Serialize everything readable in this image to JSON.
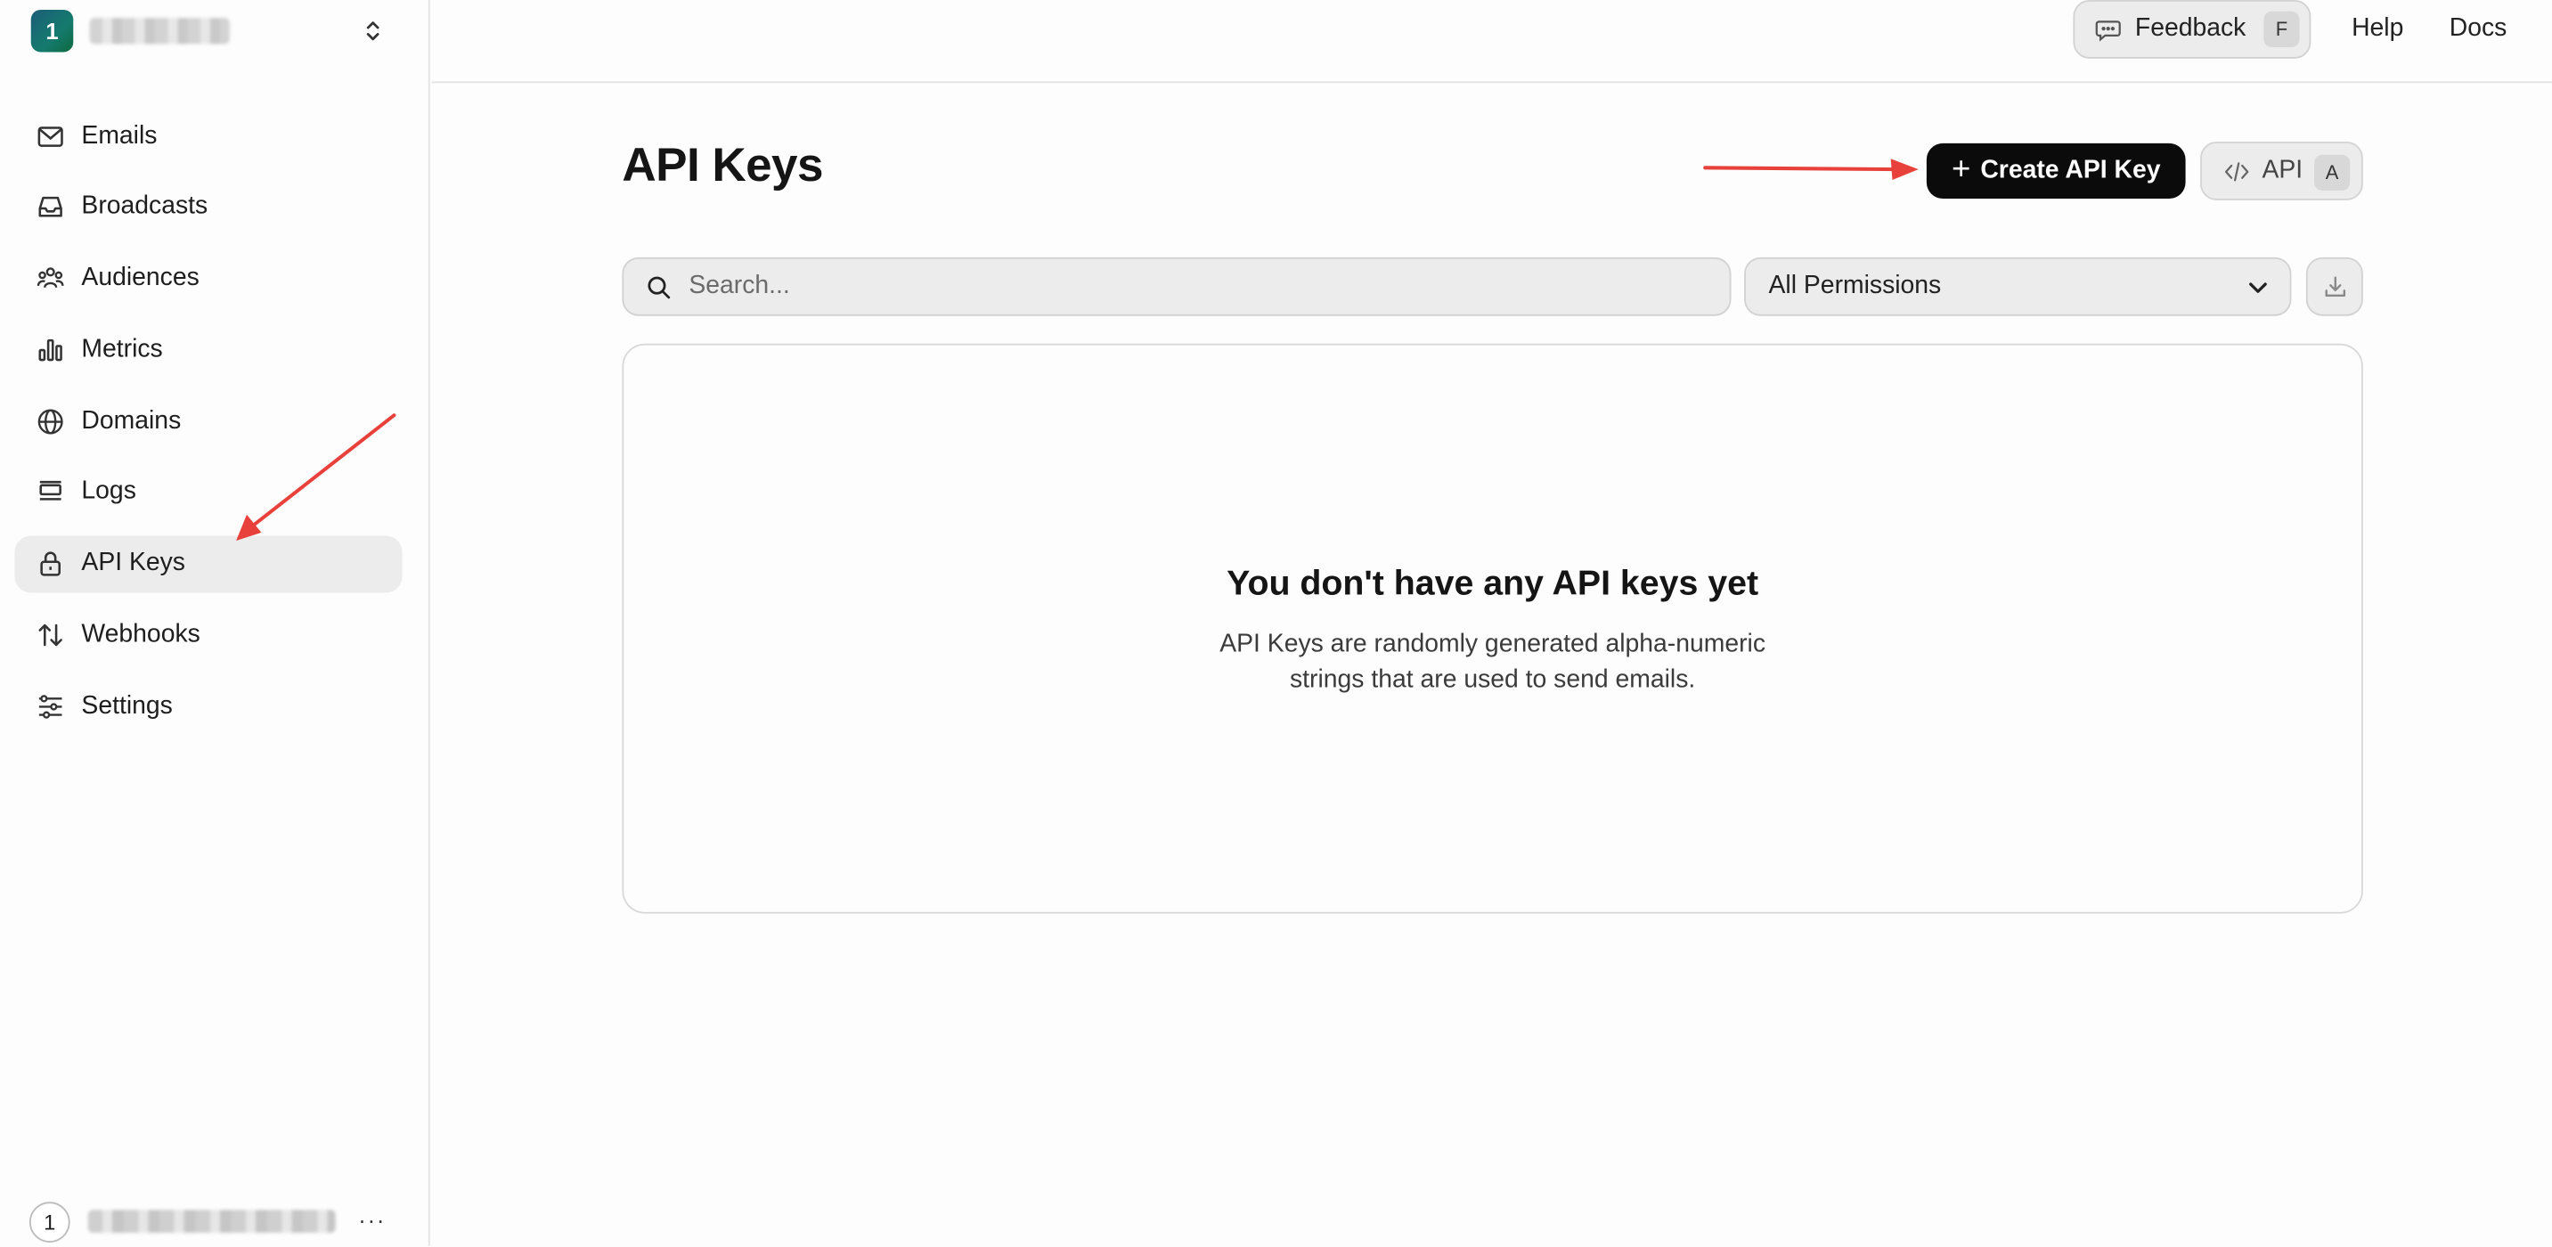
{
  "sidebar": {
    "team_initial": "1",
    "items": [
      {
        "label": "Emails",
        "icon": "mail-icon"
      },
      {
        "label": "Broadcasts",
        "icon": "inbox-icon"
      },
      {
        "label": "Audiences",
        "icon": "users-icon"
      },
      {
        "label": "Metrics",
        "icon": "bar-chart-icon"
      },
      {
        "label": "Domains",
        "icon": "globe-icon"
      },
      {
        "label": "Logs",
        "icon": "logs-icon"
      },
      {
        "label": "API Keys",
        "icon": "lock-icon",
        "active": true
      },
      {
        "label": "Webhooks",
        "icon": "arrows-up-down-icon"
      },
      {
        "label": "Settings",
        "icon": "sliders-icon"
      }
    ],
    "user_initial": "1",
    "more_label": "···"
  },
  "topbar": {
    "feedback_label": "Feedback",
    "feedback_shortcut": "F",
    "help_label": "Help",
    "docs_label": "Docs"
  },
  "main": {
    "title": "API Keys",
    "create_label": "Create API Key",
    "api_label": "API",
    "api_shortcut": "A",
    "search_placeholder": "Search...",
    "permissions_selected": "All Permissions",
    "empty_title": "You don't have any API keys yet",
    "empty_description": "API Keys are randomly generated alpha-numeric strings that are used to send emails."
  },
  "colors": {
    "primary_button": "#0b0b0b",
    "annotation_arrow": "#e8413c",
    "active_nav_bg": "#ececec"
  }
}
